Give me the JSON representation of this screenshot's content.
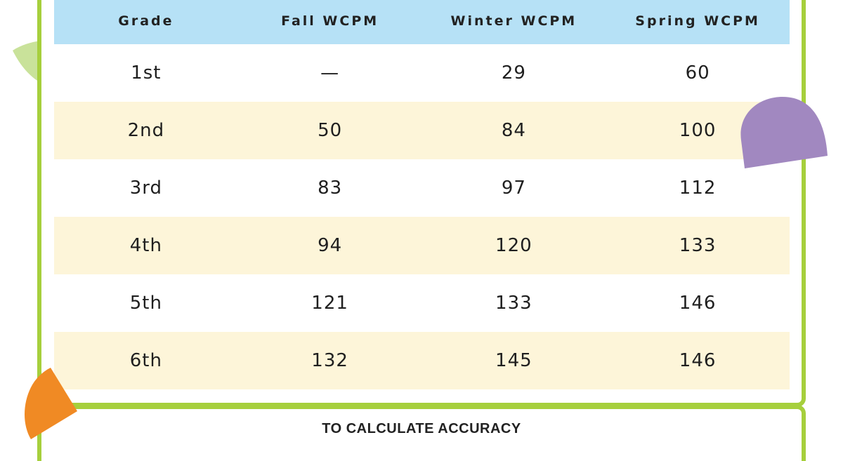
{
  "table": {
    "headers": [
      "Grade",
      "Fall WCPM",
      "Winter WCPM",
      "Spring WCPM"
    ],
    "rows": [
      [
        "1st",
        "—",
        "29",
        "60"
      ],
      [
        "2nd",
        "50",
        "84",
        "100"
      ],
      [
        "3rd",
        "83",
        "97",
        "112"
      ],
      [
        "4th",
        "94",
        "120",
        "133"
      ],
      [
        "5th",
        "121",
        "133",
        "146"
      ],
      [
        "6th",
        "132",
        "145",
        "146"
      ]
    ]
  },
  "footer": {
    "heading": "TO CALCULATE ACCURACY"
  },
  "colors": {
    "frame": "#a6cf3c",
    "header_bg": "#b6e1f6",
    "stripe_bg": "#fdf5d9",
    "deco_green": "#c9e29a",
    "deco_purple": "#a188c0",
    "deco_orange": "#f08a24"
  }
}
